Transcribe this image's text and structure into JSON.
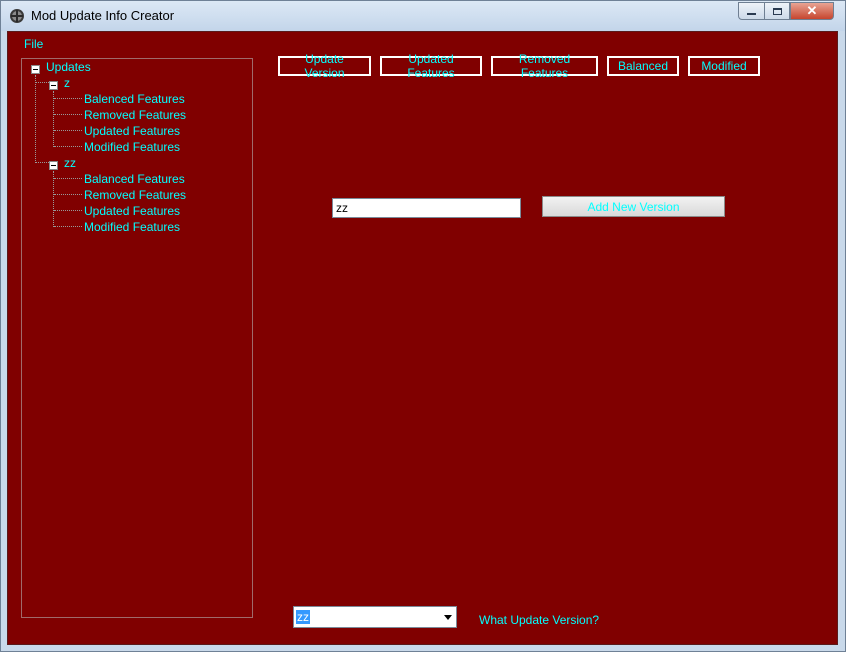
{
  "window": {
    "title": "Mod Update Info Creator",
    "close_glyph": "✕"
  },
  "menu": {
    "file": "File"
  },
  "tree": {
    "root": "Updates",
    "versions": [
      {
        "label": "z",
        "children": [
          "Balenced Features",
          "Removed Features",
          "Updated Features",
          "Modified Features"
        ]
      },
      {
        "label": "zz",
        "children": [
          "Balanced Features",
          "Removed Features",
          "Updated Features",
          "Modified Features"
        ]
      }
    ]
  },
  "tabs": {
    "update_version": "Update Version",
    "updated_features": "Updated Features",
    "removed_features": "Removed Features",
    "balanced": "Balanced",
    "modified": "Modified"
  },
  "editor": {
    "version_input_value": "zz",
    "add_button": "Add New Version"
  },
  "footer": {
    "combo_value": "zz",
    "label": "What Update Version?"
  },
  "colors": {
    "background": "#800000",
    "text": "#00ffff",
    "border": "#ffffff"
  },
  "icons": {
    "app": "app-crosshair-icon",
    "expand": "minus-expander-icon",
    "dropdown": "chevron-down-icon"
  }
}
